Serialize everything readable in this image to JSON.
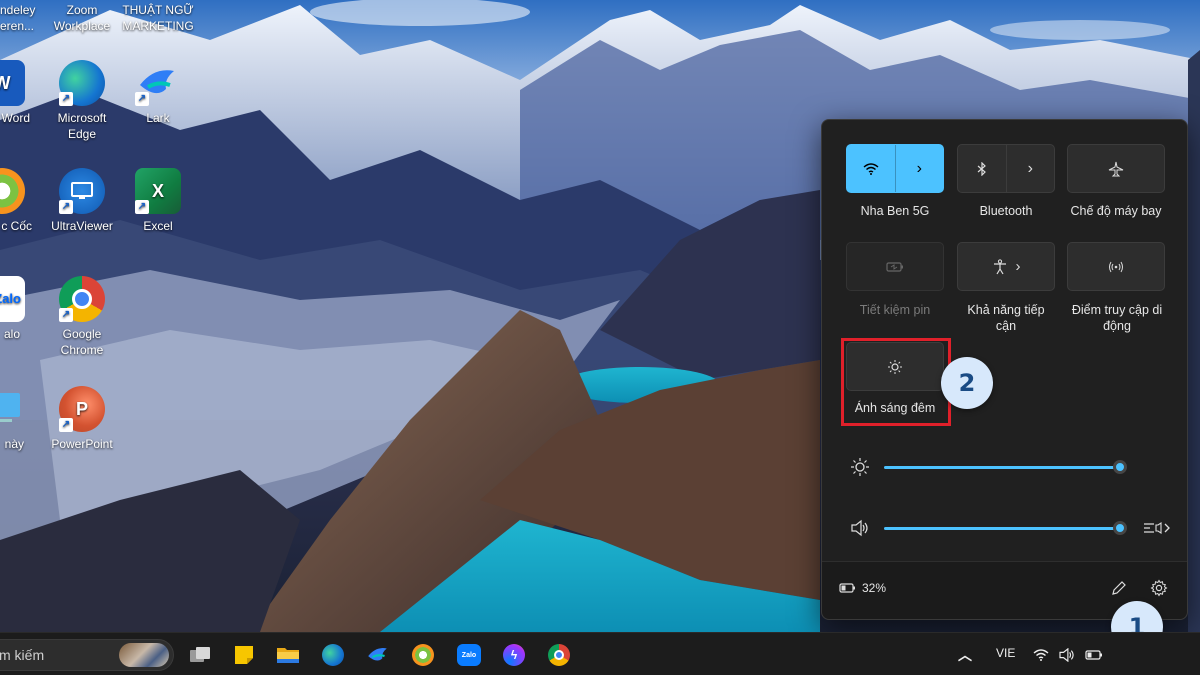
{
  "desktop": {
    "partial_labels": {
      "top_left_line1": "ndeley",
      "top_left_line2": "eren...",
      "word": "Word",
      "coc_coc": "c Cốc",
      "zalo": "alo",
      "this_pc": "này"
    },
    "icons": [
      {
        "name": "zoom",
        "line1": "Zoom",
        "line2": "Workplace"
      },
      {
        "name": "thuat-ngu",
        "line1": "THUẬT NGỮ",
        "line2": "MARKETING"
      },
      {
        "name": "edge",
        "line1": "Microsoft",
        "line2": "Edge"
      },
      {
        "name": "lark",
        "line1": "Lark",
        "line2": ""
      },
      {
        "name": "ultraviewer",
        "line1": "UltraViewer",
        "line2": ""
      },
      {
        "name": "excel",
        "line1": "Excel",
        "line2": ""
      },
      {
        "name": "chrome",
        "line1": "Google",
        "line2": "Chrome"
      },
      {
        "name": "powerpoint",
        "line1": "PowerPoint",
        "line2": ""
      }
    ]
  },
  "quick_settings": {
    "tiles": [
      {
        "label": "Nha Ben 5G",
        "icon": "wifi-icon",
        "state": "on",
        "has_chevron": true
      },
      {
        "label": "Bluetooth",
        "icon": "bluetooth-icon",
        "state": "off",
        "has_chevron": true
      },
      {
        "label": "Chế độ máy bay",
        "icon": "airplane-icon",
        "state": "off",
        "has_chevron": false
      },
      {
        "label": "Tiết kiệm pin",
        "icon": "battery-saver-icon",
        "state": "disabled",
        "has_chevron": false
      },
      {
        "label_line1": "Khả năng tiếp",
        "label_line2": "cận",
        "icon": "accessibility-icon",
        "state": "off",
        "has_chevron": true
      },
      {
        "label_line1": "Điểm truy cập di",
        "label_line2": "động",
        "icon": "hotspot-icon",
        "state": "off",
        "has_chevron": false
      },
      {
        "label": "Ánh sáng đêm",
        "icon": "night-light-icon",
        "state": "off",
        "has_chevron": false
      }
    ],
    "brightness_level": 1.0,
    "volume_level": 1.0,
    "battery_text": "32%",
    "accent_color": "#4cc2ff"
  },
  "callouts": {
    "badge_1": "1",
    "badge_2": "2",
    "highlight_color": "#e0202a"
  },
  "taskbar": {
    "search_text": "m kiếm",
    "language": "VIE",
    "pinned": [
      "task-view",
      "sticky-notes",
      "file-explorer",
      "edge",
      "lark",
      "coc-coc",
      "zalo",
      "messenger",
      "chrome"
    ]
  }
}
